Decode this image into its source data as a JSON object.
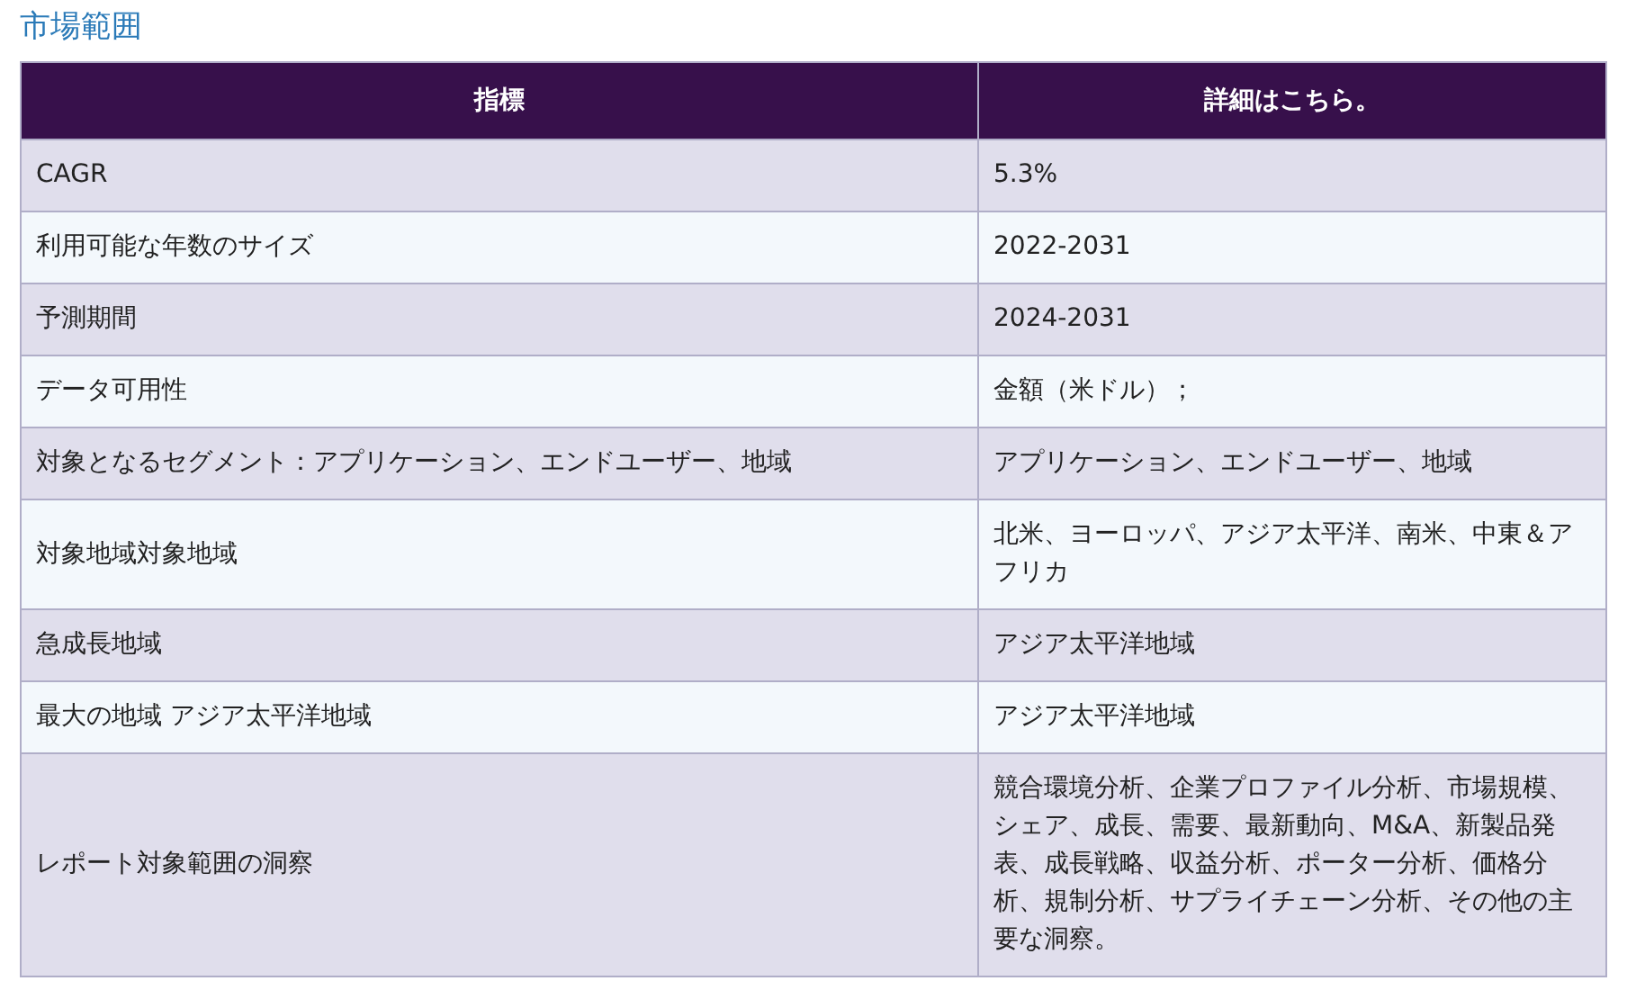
{
  "title": "市場範囲",
  "table": {
    "columns": [
      "指標",
      "詳細はこちら。"
    ],
    "rows": [
      {
        "cells": [
          "CAGR",
          "5.3%"
        ]
      },
      {
        "cells": [
          "利用可能な年数のサイズ",
          "2022-2031"
        ]
      },
      {
        "cells": [
          "予測期間",
          "2024-2031"
        ]
      },
      {
        "cells": [
          "データ可用性",
          "金額（米ドル）；"
        ]
      },
      {
        "cells": [
          "対象となるセグメント：アプリケーション、エンドユーザー、地域",
          "アプリケーション、エンドユーザー、地域"
        ]
      },
      {
        "cells": [
          "対象地域対象地域",
          "北米、ヨーロッパ、アジア太平洋、南米、中東＆アフリカ"
        ]
      },
      {
        "cells": [
          "急成長地域",
          "アジア太平洋地域"
        ]
      },
      {
        "cells": [
          "最大の地域 アジア太平洋地域",
          "アジア太平洋地域"
        ]
      },
      {
        "cells": [
          "レポート対象範囲の洞察",
          "競合環境分析、企業プロファイル分析、市場規模、シェア、成長、需要、最新動向、M&A、新製品発表、成長戦略、収益分析、ポーター分析、価格分析、規制分析、サプライチェーン分析、その他の主要な洞察。"
        ]
      }
    ]
  }
}
